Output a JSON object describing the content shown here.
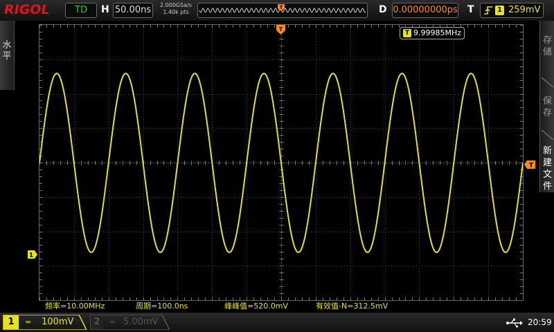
{
  "topbar": {
    "brand": "RIGOL",
    "run_state": "TD",
    "h_label": "H",
    "timebase": "50.00ns",
    "sample_rate": "2.000GSa/s",
    "mem_depth": "1.40k pts",
    "d_label": "D",
    "delay": "0.00000000ps",
    "t_label": "T",
    "trigger_source": "1",
    "trigger_level": "259mV"
  },
  "left_menu": {
    "label": "水平"
  },
  "right_menu": {
    "items": [
      {
        "label": "存储"
      },
      {
        "label": "保存"
      },
      {
        "label": "新建文件"
      }
    ]
  },
  "display": {
    "frequency_counter": "9.99985MHz",
    "frequency_counter_source": "T",
    "channel1_marker": "1",
    "trigger_marker": "T",
    "trigger_position_marker": "T"
  },
  "measurements": [
    {
      "text": "频率=10.00MHz"
    },
    {
      "text": "周期=100.0ns"
    },
    {
      "text": "峰峰值=520.0mV"
    },
    {
      "text": "有效值-N=312.5mV"
    }
  ],
  "channels": [
    {
      "number": "1",
      "coupling": "=",
      "scale": "100mV",
      "color": "#e6e21e",
      "active": true
    },
    {
      "number": "2",
      "coupling": "=",
      "scale": "5.00mV",
      "color": "#23b5e8",
      "active": false
    }
  ],
  "status": {
    "usb_icon": "usb-icon",
    "time": "20:59"
  },
  "colors": {
    "ch1": "#e6e21e",
    "ch2": "#23b5e8",
    "trigger": "#ff8a1c",
    "brand": "#e8101a"
  },
  "chart_data": {
    "type": "line",
    "series": [
      {
        "name": "1",
        "waveform": "sine",
        "frequency_hz": 10000000,
        "period_s": 1e-07,
        "peak_to_peak_v": 0.52,
        "cycles_on_screen": 7,
        "screen_time_span_s": 7e-07
      }
    ],
    "xlabel": "",
    "ylabel": "",
    "x_divisions": 14,
    "y_divisions": 8,
    "grid": true
  }
}
